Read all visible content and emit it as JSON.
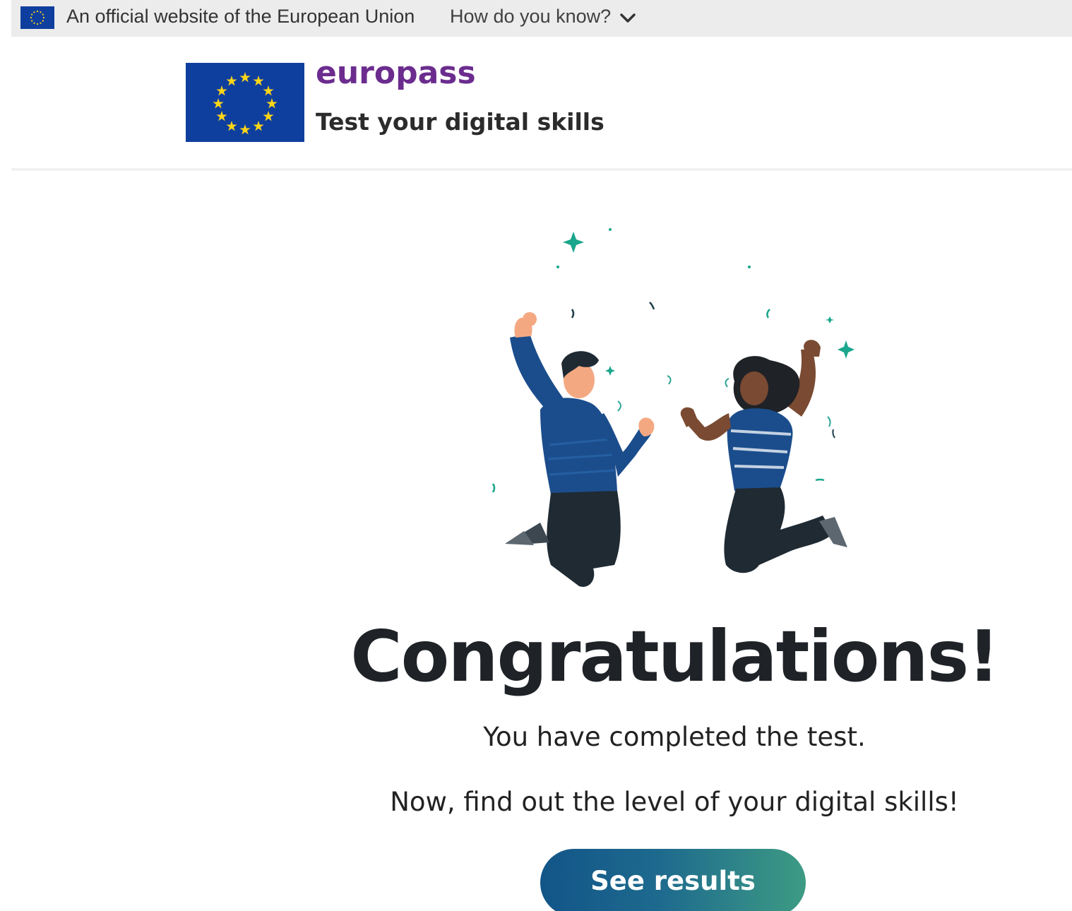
{
  "eu_banner": {
    "official_text": "An official website of the European Union",
    "how_link": "How do you know?",
    "chevron_icon": "chevron-down-icon",
    "flag_icon": "eu-flag-icon"
  },
  "header": {
    "brand": "europass",
    "subtitle": "Test your digital skills",
    "logo_icon": "eu-flag-logo"
  },
  "colors": {
    "eu_blue": "#0f3f9e",
    "eu_gold": "#ffd617",
    "brand_purple": "#6b2c8e",
    "button_start": "#125588",
    "button_end": "#3d9b83",
    "sparkle": "#1aa68c"
  },
  "main": {
    "illustration": "celebrating-people-illustration",
    "heading": "Congratulations!",
    "line1": "You have completed the test.",
    "line2": "Now, find out the level of your digital skills!",
    "button_label": "See results"
  }
}
